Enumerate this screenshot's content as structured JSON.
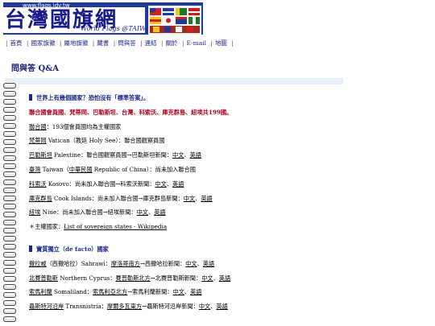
{
  "banner": {
    "url": "www.flags.idv.tw",
    "logo_text": "台灣國旗網",
    "subtitle": "World Flags @TAIWAN"
  },
  "nav": [
    "首頁",
    "國家旗徽",
    "屬地旗徽",
    "藏書",
    "問與答",
    "連結",
    "關於",
    "E-mail",
    "地圖"
  ],
  "page_title": "問與答 Q&A",
  "section1": {
    "heading": "世界上有幾個國家？恐怕沒有「標準答案」。",
    "summary": "聯合國會員國、梵蒂岡、巴勒斯坦、台灣、科索沃、庫克群島、紐埃共199國。",
    "rows": [
      {
        "link": "聯合國",
        "text": "：193個會員國均為主權國家"
      },
      {
        "link": "梵蒂岡",
        "text": " Vatican（教廷 Holy See）：聯合國觀察員國"
      },
      {
        "link": "巴勒斯坦",
        "text": " Palestine：聯合國觀察員國→巴勒斯坦新聞：",
        "l1": "中文",
        "sep": "、",
        "l2": "英語"
      },
      {
        "link": "臺灣",
        "text": " Taiwan（",
        "link_b": "中華民國",
        "text_b": " Republic of China）：尚未加入聯合國"
      },
      {
        "link": "科索沃",
        "text": " Kosovo：尚未加入聯合國→科索沃新聞：",
        "l1": "中文",
        "sep": "、",
        "l2": "英語"
      },
      {
        "link": "庫克群島",
        "text": " Cook Islands：尚未加入聯合國→庫克群島新聞：",
        "l1": "中文",
        "sep": "、",
        "l2": "英語"
      },
      {
        "link": "紐埃",
        "text": " Niue：尚未加入聯合國→紐埃新聞：",
        "l1": "中文",
        "sep": "、",
        "l2": "英語"
      }
    ],
    "sovereign_prefix": "＊主權國家：",
    "sovereign_link": "List of sovereign states - Wikipedia"
  },
  "section2": {
    "heading": "實質獨立（de facto）國家",
    "rows": [
      {
        "link": "撒拉威",
        "text": "（西撒哈拉）Sahrawi：",
        "link_b": "摩洛哥南方",
        "text_b": "→西撒哈拉新聞：",
        "l1": "中文",
        "sep": "、",
        "l2": "英語"
      },
      {
        "link": "北賽普勒斯",
        "text": " Northern Cyprus：",
        "link_b": "賽普勒斯北方",
        "text_b": "→北賽普勒斯新聞：",
        "l1": "中文",
        "sep": "、",
        "l2": "英語"
      },
      {
        "link": "索馬利蘭",
        "text": " Somaliland：",
        "link_b": "索馬利亞北方",
        "text_b": "→索馬利蘭新聞：",
        "l1": "中文",
        "sep": "、",
        "l2": "英語"
      },
      {
        "link": "聶斯特河沿岸",
        "text": " Transnistria：",
        "link_b": "摩爾多瓦東方",
        "text_b": "→聶斯特河沿岸新聞：",
        "l1": "中文",
        "sep": "、",
        "l2": "英語"
      }
    ]
  },
  "colors": {
    "accent": "#1a2a8a",
    "highlight": "#b00020",
    "banner_blue": "#1f3a9a"
  }
}
